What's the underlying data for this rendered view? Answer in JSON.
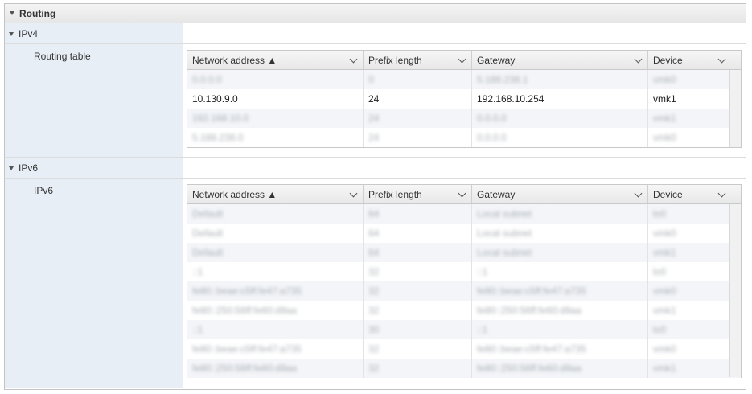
{
  "panel": {
    "title": "Routing"
  },
  "ipv4": {
    "section_label": "IPv4",
    "body_label": "Routing table",
    "columns": [
      "Network address ▲",
      "Prefix length",
      "Gateway",
      "Device"
    ],
    "rows": [
      [
        "0.0.0.0",
        "0",
        "5.188.238.1",
        "vmk0"
      ],
      [
        "10.130.9.0",
        "24",
        "192.168.10.254",
        "vmk1"
      ],
      [
        "192.168.10.0",
        "24",
        "0.0.0.0",
        "vmk1"
      ],
      [
        "5.188.238.0",
        "24",
        "0.0.0.0",
        "vmk0"
      ]
    ]
  },
  "ipv6": {
    "section_label": "IPv6",
    "body_label": "IPv6",
    "columns": [
      "Network address ▲",
      "Prefix length",
      "Gateway",
      "Device"
    ],
    "rows": [
      [
        "Default",
        "64",
        "Local subnet",
        "lo0"
      ],
      [
        "Default",
        "64",
        "Local subnet",
        "vmk0"
      ],
      [
        "Default",
        "64",
        "Local subnet",
        "vmk1"
      ],
      [
        "::1",
        "32",
        "::1",
        "lo0"
      ],
      [
        "fe80::beae:c5ff:fe47:a735",
        "32",
        "fe80::beae:c5ff:fe47:a735",
        "vmk0"
      ],
      [
        "fe80::250:56ff:fe60:d9aa",
        "32",
        "fe80::250:56ff:fe60:d9aa",
        "vmk1"
      ],
      [
        "::1",
        "30",
        "::1",
        "lo0"
      ],
      [
        "fe80::beae:c5ff:fe47:a735",
        "32",
        "fe80::beae:c5ff:fe47:a735",
        "vmk0"
      ],
      [
        "fe80::250:56ff:fe60:d9aa",
        "32",
        "fe80::250:56ff:fe60:d9aa",
        "vmk1"
      ]
    ]
  }
}
